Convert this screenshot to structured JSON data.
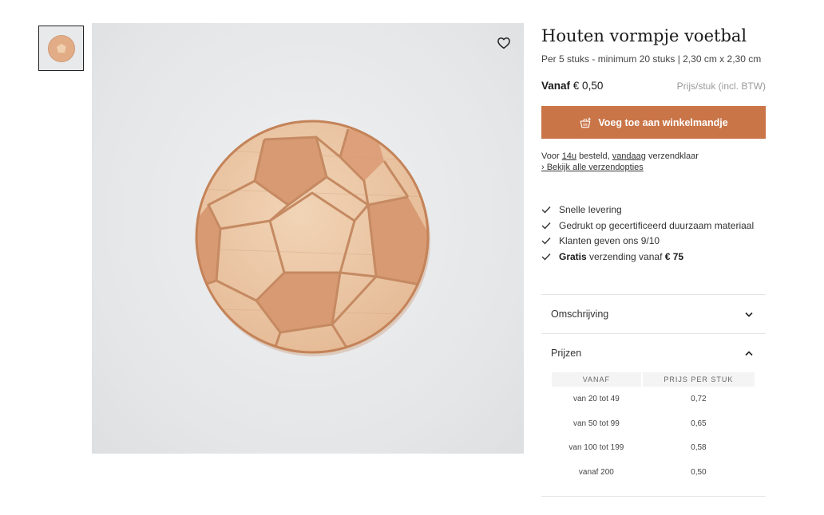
{
  "product": {
    "title": "Houten vormpje voetbal",
    "subtitle": "Per 5 stuks - minimum 20 stuks | 2,30 cm x 2,30 cm",
    "price_prefix": "Vanaf",
    "price_value": "€ 0,50",
    "price_note": "Prijs/stuk (incl. BTW)"
  },
  "cart": {
    "button_label": "Voeg toe aan winkelmandje",
    "icon": "cart-plus-icon"
  },
  "shipping": {
    "line1_a": "Voor ",
    "line1_time": "14u",
    "line1_b": " besteld, ",
    "line1_day": "vandaag",
    "line1_c": " verzendklaar",
    "link": "› Bekijk alle verzendopties"
  },
  "usps": [
    {
      "text": "Snelle levering"
    },
    {
      "text": "Gedrukt op gecertificeerd duurzaam materiaal"
    },
    {
      "text": "Klanten geven ons 9/10"
    },
    {
      "bold1": "Gratis",
      "text": " verzending vanaf ",
      "bold2": "€ 75"
    }
  ],
  "accordion": {
    "description_label": "Omschrijving",
    "prices_label": "Prijzen"
  },
  "price_table": {
    "headers": [
      "VANAF",
      "PRIJS PER STUK"
    ],
    "rows": [
      [
        "van 20 tot 49",
        "0,72"
      ],
      [
        "van 50 tot 99",
        "0,65"
      ],
      [
        "van 100 tot 199",
        "0,58"
      ],
      [
        "vanaf 200",
        "0,50"
      ]
    ]
  },
  "icons": {
    "wishlist": "heart-icon",
    "check": "check-icon",
    "expand": "chevron-down-icon",
    "collapse": "chevron-up-icon"
  },
  "colors": {
    "accent": "#c97548",
    "wood": "#e7bd94"
  }
}
